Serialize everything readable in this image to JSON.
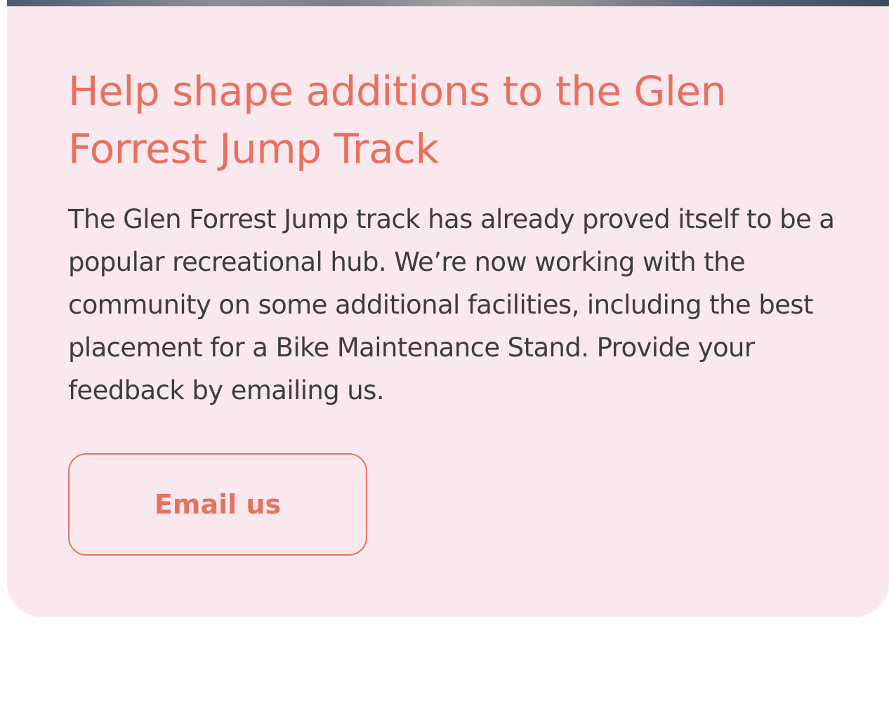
{
  "card": {
    "title": "Help shape additions to the Glen Forrest Jump Track",
    "body": "The Glen Forrest Jump track has already proved itself to be a popular recreational hub. We’re now working with the community on some additional facilities, including the best placement for a Bike Maintenance Stand. Provide your feedback by emailing us.",
    "button_label": "Email us"
  },
  "colors": {
    "accent": "#e8705f",
    "card_background": "#f9e9ee",
    "body_text": "#3d3d3d"
  }
}
